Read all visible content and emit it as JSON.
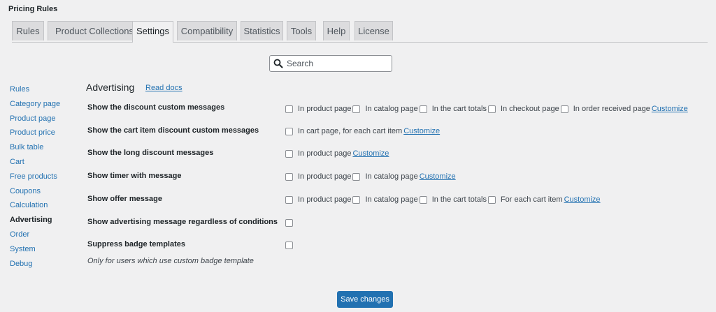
{
  "page": {
    "title": "Pricing Rules"
  },
  "tabs": [
    {
      "label": "Rules"
    },
    {
      "label": "Product Collections"
    },
    {
      "label": "Settings"
    },
    {
      "label": "Compatibility"
    },
    {
      "label": "Statistics"
    },
    {
      "label": "Tools"
    },
    {
      "label": "Help"
    },
    {
      "label": "License"
    }
  ],
  "active_tab": "Settings",
  "search": {
    "placeholder": "Search",
    "value": ""
  },
  "sidebar": {
    "items": [
      {
        "label": "Rules"
      },
      {
        "label": "Category page"
      },
      {
        "label": "Product page"
      },
      {
        "label": "Product price"
      },
      {
        "label": "Bulk table"
      },
      {
        "label": "Cart"
      },
      {
        "label": "Free products"
      },
      {
        "label": "Coupons"
      },
      {
        "label": "Calculation"
      },
      {
        "label": "Advertising"
      },
      {
        "label": "Order"
      },
      {
        "label": "System"
      },
      {
        "label": "Debug"
      }
    ],
    "active": "Advertising"
  },
  "section": {
    "title": "Advertising",
    "docs_link": "Read docs"
  },
  "settings": {
    "rows": [
      {
        "label": "Show the discount custom messages",
        "options": [
          "In product page",
          "In catalog page",
          "In the cart totals",
          "In checkout page",
          "In order received page"
        ],
        "customize": "Customize"
      },
      {
        "label": "Show the cart item discount custom messages",
        "options": [
          "In cart page, for each cart item"
        ],
        "customize": "Customize"
      },
      {
        "label": "Show the long discount messages",
        "options": [
          "In product page"
        ],
        "customize": "Customize"
      },
      {
        "label": "Show timer with message",
        "options": [
          "In product page",
          "In catalog page"
        ],
        "customize": "Customize"
      },
      {
        "label": "Show offer message",
        "options": [
          "In product page",
          "In catalog page",
          "In the cart totals",
          "For each cart item"
        ],
        "customize": "Customize"
      },
      {
        "label": "Show advertising message regardless of conditions",
        "options": [
          ""
        ]
      },
      {
        "label": "Suppress badge templates",
        "options": [
          ""
        ],
        "note": "Only for users which use custom badge template"
      }
    ]
  },
  "footer": {
    "save_label": "Save changes"
  },
  "colors": {
    "accent": "#2271b1",
    "background": "#f0f0f1",
    "border": "#c3c4c7"
  },
  "icons": {
    "search": "search-icon"
  }
}
